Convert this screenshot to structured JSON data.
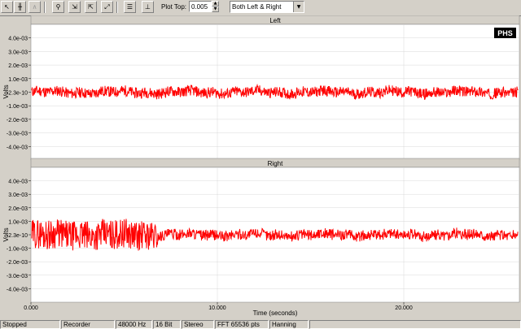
{
  "toolbar": {
    "plot_top_label": "Plot Top:",
    "plot_top_value": "0.005",
    "channel_select": "Both Left & Right",
    "icons": [
      "cursor-icon",
      "waveform-icon",
      "zoom-icon",
      "zoom-in-2x-icon",
      "zoom-out-2x-icon",
      "zoom-full-icon",
      "settings-icon",
      "cursor-marker-icon"
    ]
  },
  "panels": {
    "left_title": "Left",
    "right_title": "Right",
    "y_axis_label": "Volts",
    "x_axis_label": "Time (seconds)",
    "logo_text": "PHS"
  },
  "status": {
    "state": "Stopped",
    "mode": "Recorder",
    "sample_rate": "48000 Hz",
    "bits": "16 Bit",
    "channels": "Stereo",
    "fft": "FFT 65536 pts",
    "window": "Hanning"
  },
  "colors": {
    "trace": "#ff0000",
    "grid": "#d8d8d8",
    "plot_bg": "#ffffff",
    "frame": "#d4d0c8"
  },
  "chart_data": [
    {
      "type": "line",
      "title": "Left",
      "xlabel": "Time (seconds)",
      "ylabel": "Volts",
      "xlim": [
        0,
        26.2
      ],
      "ylim": [
        -0.005,
        0.005
      ],
      "x_ticks": [
        "0.000",
        "10.000",
        "20.000"
      ],
      "y_ticks": [
        "4.0e-03",
        "3.0e-03",
        "2.0e-03",
        "1.0e-03",
        "-2.3e-10",
        "-1.0e-03",
        "-2.0e-03",
        "-3.0e-03",
        "-4.0e-03"
      ],
      "y_tick_values": [
        0.004,
        0.003,
        0.002,
        0.001,
        0,
        -0.001,
        -0.002,
        -0.003,
        -0.004
      ],
      "series": [
        {
          "noise_amplitude": 0.0004,
          "offset": 0
        }
      ],
      "grid": true
    },
    {
      "type": "line",
      "title": "Right",
      "xlabel": "Time (seconds)",
      "ylabel": "Volts",
      "xlim": [
        0,
        26.2
      ],
      "ylim": [
        -0.005,
        0.005
      ],
      "x_ticks": [
        "0.000",
        "10.000",
        "20.000"
      ],
      "y_ticks": [
        "4.0e-03",
        "3.0e-03",
        "2.0e-03",
        "1.0e-03",
        "-2.3e-10",
        "-1.0e-03",
        "-2.0e-03",
        "-3.0e-03",
        "-4.0e-03"
      ],
      "y_tick_values": [
        0.004,
        0.003,
        0.002,
        0.001,
        0,
        -0.001,
        -0.002,
        -0.003,
        -0.004
      ],
      "series": [
        {
          "noise_amplitude": 0.0004,
          "offset": 0,
          "burst_end_seconds": 6.8,
          "burst_amplitude": 0.0011
        }
      ],
      "grid": true
    }
  ]
}
